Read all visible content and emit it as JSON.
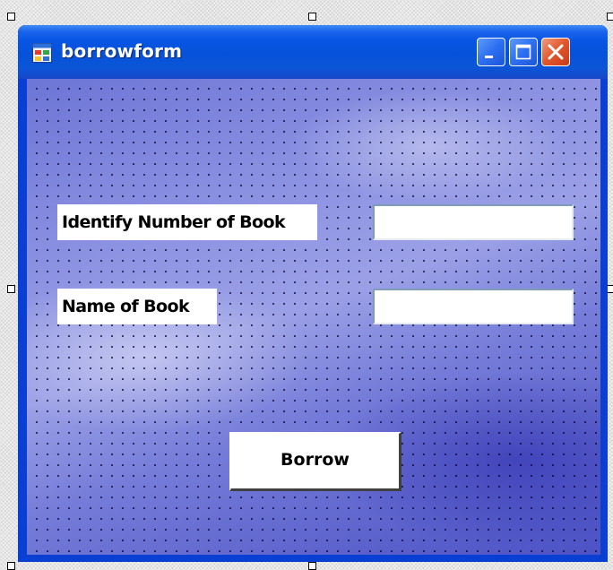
{
  "window": {
    "title": "borrowform",
    "icon": "form-icon",
    "controls": {
      "minimize_icon": "minimize-icon",
      "maximize_icon": "maximize-icon",
      "close_icon": "close-icon"
    }
  },
  "form": {
    "identify_number_label": "Identify Number of Book",
    "identify_number_value": "",
    "name_label": "Name of Book",
    "name_value": "",
    "borrow_button": "Borrow"
  },
  "colors": {
    "titlebar": "#0854e4",
    "close_button": "#e2562b",
    "client_background": "#6d75d6"
  }
}
